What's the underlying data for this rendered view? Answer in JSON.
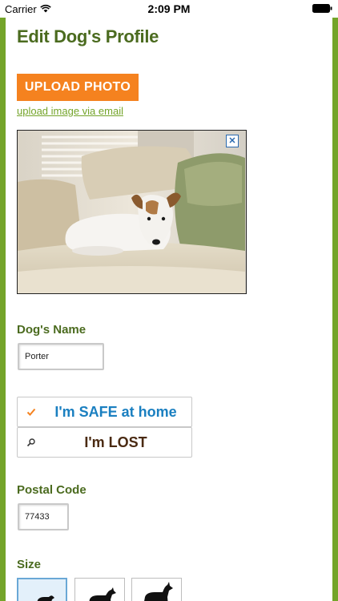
{
  "status_bar": {
    "carrier": "Carrier",
    "time": "2:09 PM"
  },
  "header": {
    "title": "Edit Dog's Profile"
  },
  "photo": {
    "upload_label": "UPLOAD PHOTO",
    "email_link": "upload image via email",
    "remove_label": "✕"
  },
  "dog_name": {
    "label": "Dog's Name",
    "value": "Porter"
  },
  "status_options": [
    {
      "label": "I'm SAFE at home",
      "icon": "checkmark-icon",
      "color": "#1a7fc0"
    },
    {
      "label": "I'm LOST",
      "icon": "magnifier-icon",
      "color": "#4a2a12"
    }
  ],
  "postal_code": {
    "label": "Postal Code",
    "value": "77433"
  },
  "size": {
    "label": "Size",
    "options": [
      "small-dog-icon",
      "medium-dog-icon",
      "large-dog-icon"
    ],
    "selected_index": 0
  },
  "colors": {
    "accent_green": "#74a42a",
    "title_green": "#4b6b1f",
    "upload_orange": "#f5821f"
  }
}
